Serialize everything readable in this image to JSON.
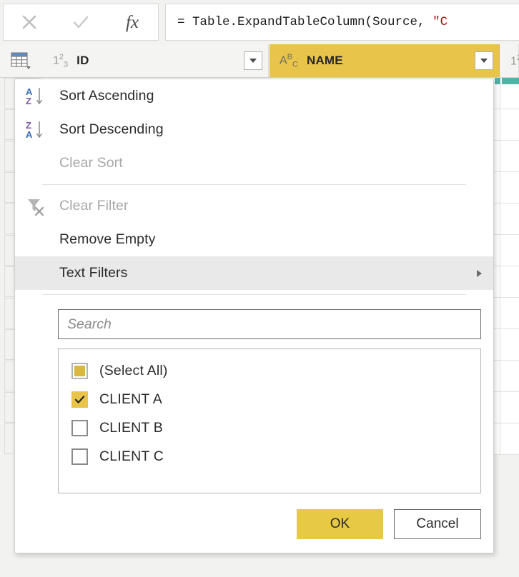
{
  "formula_bar": {
    "cancel_icon": "close-icon",
    "accept_icon": "checkmark-icon",
    "fx_label": "fx",
    "formula_prefix": "= Table.ExpandTableColumn(Source, ",
    "formula_string": "\"C"
  },
  "grid": {
    "corner_icon": "table-grid-icon",
    "columns": [
      {
        "type_icon": "123",
        "label": "ID",
        "selected": false
      },
      {
        "type_icon": "ABC",
        "label": "NAME",
        "selected": true
      },
      {
        "type_icon": "12",
        "label": "",
        "selected": false
      }
    ],
    "accent_color": "#e8c44a",
    "quality_bar_color": "#4fb3a5"
  },
  "filter_popup": {
    "menu_items": [
      {
        "label": "Sort Ascending",
        "icon": "sort-ascending-icon",
        "disabled": false,
        "hovered": false,
        "submenu": false
      },
      {
        "label": "Sort Descending",
        "icon": "sort-descending-icon",
        "disabled": false,
        "hovered": false,
        "submenu": false
      },
      {
        "label": "Clear Sort",
        "icon": "none",
        "disabled": true,
        "hovered": false,
        "submenu": false
      },
      {
        "label": "Clear Filter",
        "icon": "clear-filter-icon",
        "disabled": true,
        "hovered": false,
        "submenu": false
      },
      {
        "label": "Remove Empty",
        "icon": "none",
        "disabled": false,
        "hovered": false,
        "submenu": false
      },
      {
        "label": "Text Filters",
        "icon": "none",
        "disabled": false,
        "hovered": true,
        "submenu": true
      }
    ],
    "search": {
      "placeholder": "Search",
      "value": ""
    },
    "list_items": [
      {
        "label": "(Select All)",
        "state": "indeterminate"
      },
      {
        "label": "CLIENT A",
        "state": "checked"
      },
      {
        "label": "CLIENT B",
        "state": "unchecked"
      },
      {
        "label": "CLIENT C",
        "state": "unchecked"
      }
    ],
    "buttons": {
      "ok": "OK",
      "cancel": "Cancel"
    }
  }
}
